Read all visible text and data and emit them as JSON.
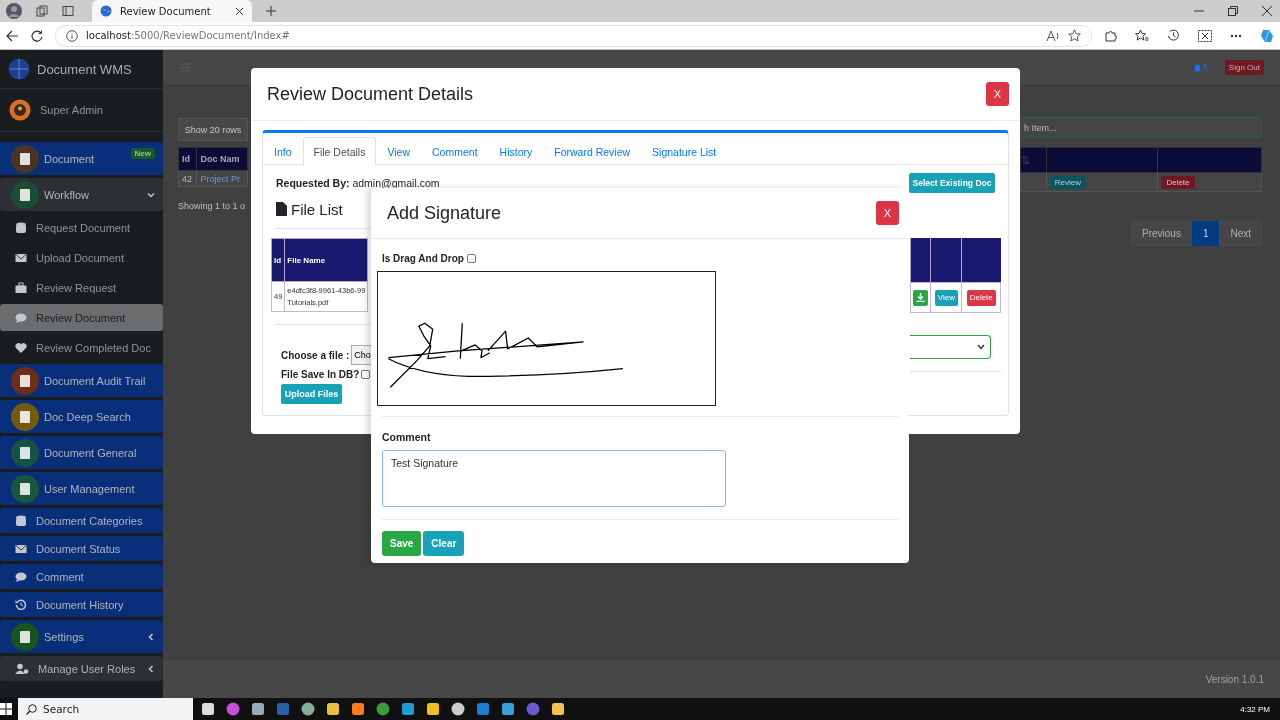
{
  "browser": {
    "tab_title": "Review Document",
    "url_host": "localhost",
    "url_path": ":5000/ReviewDocument/Index#"
  },
  "app": {
    "brand": "Document WMS",
    "user": "Super Admin"
  },
  "sidebar": {
    "items": [
      {
        "label": "Document",
        "kind": "section",
        "color": "#4a3522",
        "badge": "New",
        "active": false
      },
      {
        "label": "Workflow",
        "kind": "section",
        "color": "#1c4d33",
        "active": true,
        "expanded": true,
        "children": [
          {
            "label": "Request Document",
            "selected": false
          },
          {
            "label": "Upload Document",
            "selected": false
          },
          {
            "label": "Review Request",
            "selected": false
          },
          {
            "label": "Review Document",
            "selected": true
          },
          {
            "label": "Review Completed Doc",
            "selected": false
          }
        ]
      },
      {
        "label": "Document Audit Trail",
        "kind": "section",
        "color": "#6b2e18",
        "active": false
      },
      {
        "label": "Doc Deep Search",
        "kind": "section",
        "color": "#735a10",
        "active": false
      },
      {
        "label": "Document General",
        "kind": "section",
        "color": "#145443",
        "active": false
      },
      {
        "label": "User Management",
        "kind": "section",
        "color": "#17573b",
        "active": false
      },
      {
        "label": "Document Categories",
        "kind": "link",
        "active": false
      },
      {
        "label": "Document Status",
        "kind": "link",
        "active": false
      },
      {
        "label": "Comment",
        "kind": "link",
        "active": false
      },
      {
        "label": "Document History",
        "kind": "link",
        "active": false
      },
      {
        "label": "Settings",
        "kind": "section",
        "color": "#18541f",
        "active": false,
        "expanded": false
      },
      {
        "label": "Manage User Roles",
        "kind": "link",
        "active": true,
        "expanded": false
      }
    ]
  },
  "topbar": {
    "notification_count": "7",
    "sign_out": "Sign Out"
  },
  "background_list": {
    "show_rows": "Show 20 rows",
    "search_placeholder": "h Item...",
    "columns": [
      "Id",
      "Doc Nam"
    ],
    "rows": [
      {
        "id": "42",
        "doc_name": "Project Pr",
        "actions": [
          "Review",
          "Delete"
        ]
      }
    ],
    "info": "Showing 1 to 1 o",
    "pagination": [
      {
        "label": "Previous",
        "selected": false
      },
      {
        "label": "1",
        "selected": true
      },
      {
        "label": "Next",
        "selected": false
      }
    ]
  },
  "footer": {
    "version": "Version 1.0.1"
  },
  "review_modal": {
    "title": "Review Document Details",
    "close": "X",
    "tabs": [
      {
        "label": "Info",
        "selected": false
      },
      {
        "label": "File Details",
        "selected": true
      },
      {
        "label": "View",
        "selected": false
      },
      {
        "label": "Comment",
        "selected": false
      },
      {
        "label": "History",
        "selected": false
      },
      {
        "label": "Forward Review",
        "selected": false
      },
      {
        "label": "Signature List",
        "selected": false
      }
    ],
    "requested_by_label": "Requested By:",
    "requested_by": "admin@gmail.com",
    "select_existing": "Select Existing Doc",
    "file_list_title": "File List",
    "file_columns": [
      "Id",
      "File Name"
    ],
    "files": [
      {
        "id": "49",
        "name_lines": [
          "e4dfc3f8-9961-43b6-99",
          "Tutorials.pdf"
        ],
        "actions": [
          "View",
          "Delete"
        ]
      }
    ],
    "choose_file_label": "Choose a file :",
    "choose_file_button": "Cho",
    "save_in_db": {
      "label": "File Save In DB?",
      "checked": false
    },
    "upload": "Upload Files"
  },
  "signature_modal": {
    "title": "Add Signature",
    "close": "X",
    "drag_and_drop": {
      "label": "Is Drag And Drop",
      "checked": false
    },
    "comment_label": "Comment",
    "comment_value": "Test Signature",
    "buttons": [
      {
        "label": "Save",
        "kind": "save"
      },
      {
        "label": "Clear",
        "kind": "clear"
      }
    ]
  },
  "taskbar": {
    "search": "Search",
    "time": "4:32 PM"
  }
}
